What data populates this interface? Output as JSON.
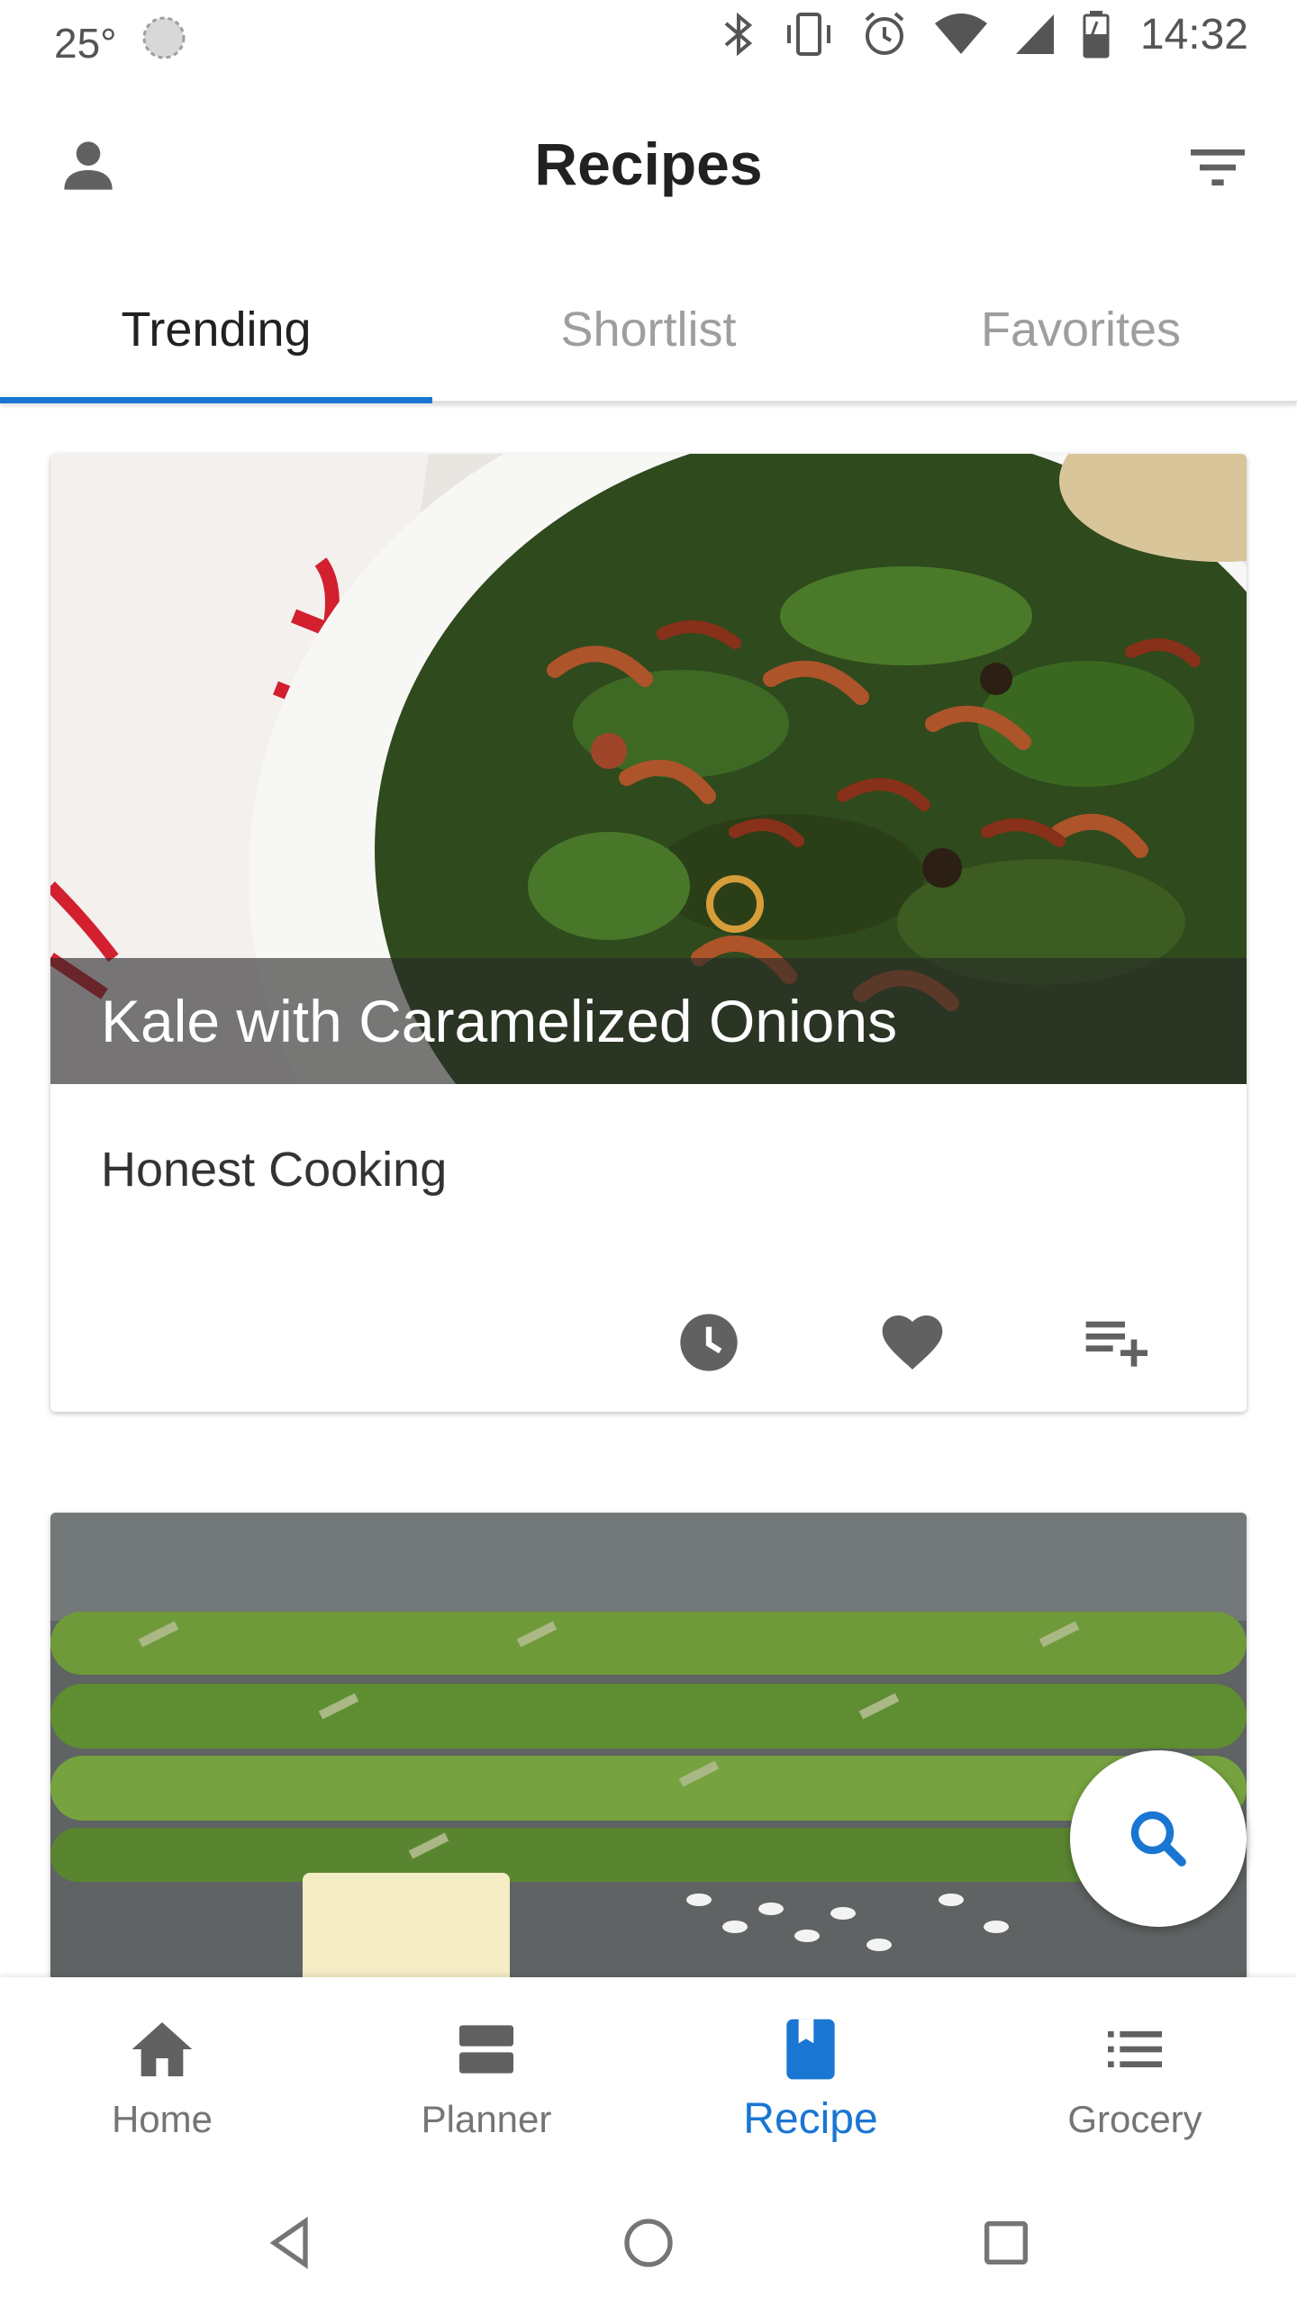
{
  "status_bar": {
    "temperature": "25°",
    "time": "14:32"
  },
  "app_bar": {
    "title": "Recipes"
  },
  "tabs": [
    {
      "label": "Trending",
      "active": true
    },
    {
      "label": "Shortlist",
      "active": false
    },
    {
      "label": "Favorites",
      "active": false
    }
  ],
  "recipes": [
    {
      "title": "Kale with Caramelized Onions",
      "source": "Honest Cooking"
    },
    {
      "title": "",
      "source": ""
    }
  ],
  "bottom_nav": [
    {
      "label": "Home",
      "icon": "home-icon",
      "active": false
    },
    {
      "label": "Planner",
      "icon": "planner-icon",
      "active": false
    },
    {
      "label": "Recipe",
      "icon": "book-icon",
      "active": true
    },
    {
      "label": "Grocery",
      "icon": "list-icon",
      "active": false
    }
  ],
  "colors": {
    "accent": "#1976d2",
    "inactive_tab": "#9e9e9e",
    "icon_gray": "#616161"
  }
}
